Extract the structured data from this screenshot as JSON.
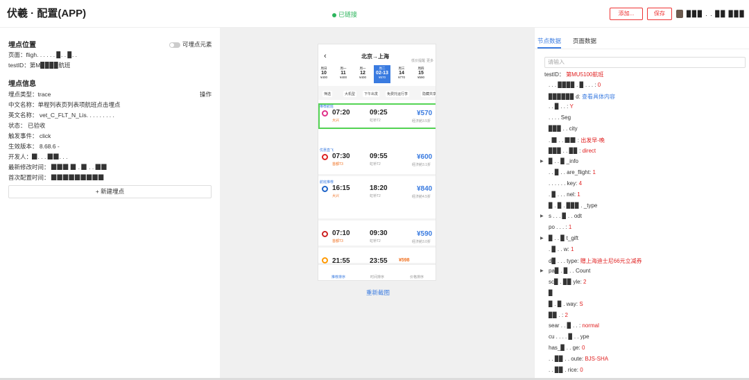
{
  "header": {
    "title": "伏羲 · 配置(APP)",
    "status": "已链接",
    "btn1": "添加...",
    "btn2": "保存",
    "user": "▉▉▉ . . ▉▉ ▉▉▉"
  },
  "left": {
    "pos_title": "埋点位置",
    "toggle_label": "可埋点元素",
    "page_row": "页面：fligh. . . . . . ▉. . ▉. .",
    "testid_row": "testID：第M▉▉▉▉航班",
    "info_title": "埋点信息",
    "ops": "操作",
    "rows": [
      "埋点类型：trace",
      "中文名称：单程列表页列表项航班点击埋点",
      "英文名称：  vet_C_FLT_N_Lis. . . . . . . . .",
      "状态：  已验收",
      "触发事件：  click",
      "生效版本：  8.68.6 -",
      "开发人：▉. . . ▉▉. . .",
      "最新修改时间：  ▉▉▉ ▉ . ▉ . . ▉▉",
      "首次配置时间：  ▉▉▉▉▉▉▉▉▉"
    ],
    "new_btn": "+ 新建埋点"
  },
  "phone": {
    "route": "北京→上海",
    "reset": "重新截图",
    "top_icons": [
      "低价提醒",
      "更多"
    ],
    "dates": [
      {
        "d": "周日",
        "n": "10",
        "p": "¥400"
      },
      {
        "d": "周一",
        "n": "11",
        "p": "¥400"
      },
      {
        "d": "周一",
        "n": "12",
        "p": "¥400"
      },
      {
        "d": "周二",
        "n": "02-13",
        "p": "¥570"
      },
      {
        "d": "周三",
        "n": "14",
        "p": "¥770"
      },
      {
        "d": "周四",
        "n": "15",
        "p": "¥590"
      }
    ],
    "filters": [
      "筛选",
      "大机型",
      "下午出发",
      "免费托运行李",
      "隐藏共享"
    ],
    "flights": [
      {
        "tag": "推荐航班",
        "dep": "07:20",
        "arr": "09:25",
        "price": "¥570",
        "dport": "大兴",
        "aport": "虹桥T2",
        "note": "经济舱3.5折"
      },
      {
        "tag": "优惠直飞",
        "dep": "07:30",
        "arr": "09:55",
        "price": "¥600",
        "dport": "首都T3",
        "aport": "虹桥T2",
        "note": "经济舱3.1折"
      },
      {
        "tag": "航班推荐",
        "dep": "16:15",
        "arr": "18:20",
        "price": "¥840",
        "dport": "大兴",
        "aport": "虹桥T2",
        "note": "经济舱4.5折"
      },
      {
        "tag": "",
        "dep": "07:10",
        "arr": "09:30",
        "price": "¥590",
        "dport": "首都T3",
        "aport": "虹桥T2",
        "note": "经济舱3.0折"
      },
      {
        "tag": "",
        "dep": "21:55",
        "arr": "23:55",
        "price": "¥598",
        "dport": "",
        "aport": "",
        "note": ""
      }
    ],
    "bottom": [
      "推荐排序",
      "时间排序",
      "价格排序"
    ]
  },
  "right": {
    "tab1": "节点数据",
    "tab2": "页面数据",
    "search_placeholder": "请输入",
    "nodes": [
      {
        "k": "testID：",
        "v": "第MU5100航班",
        "c": "",
        "t": "n"
      },
      {
        "k": ". . . ▉▉▉▉ . ▉ . . . :",
        "v": "0",
        "c": "",
        "t": "r"
      },
      {
        "k": "▉▉▉▉▉▉ d:",
        "v": "查看具体内容",
        "c": "",
        "t": "b"
      },
      {
        "k": ". . ▉ . . :",
        "v": "Y",
        "c": "",
        "t": "r"
      },
      {
        "k": ". . . . Seg",
        "v": "",
        "c": "",
        "t": "n"
      },
      {
        "k": "▉▉▉ . . city",
        "v": "",
        "c": "",
        "t": "n"
      },
      {
        "k": ". ▉ . . ▉▉ :",
        "v": "出发早-晚",
        "c": "",
        "t": "r"
      },
      {
        "k": "▉▉▉ . . ▉▉ :",
        "v": "direct",
        "c": "",
        "t": "r"
      },
      {
        "k": "▉ . . ▉ _info",
        "v": "",
        "c": "▶",
        "t": "n"
      },
      {
        "k": ". . ▉ . . are_flight:",
        "v": "1",
        "c": "",
        "t": "r"
      },
      {
        "k": ". . . . . . key:",
        "v": "4",
        "c": "",
        "t": "r"
      },
      {
        "k": ". ▉ . . . nel:",
        "v": "1",
        "c": "",
        "t": "r"
      },
      {
        "k": "▉ . ▉ . ▉▉▉ . _type",
        "v": "",
        "c": "",
        "t": "n"
      },
      {
        "k": "s . . . ▉ . . odt",
        "v": "",
        "c": "▶",
        "t": "n"
      },
      {
        "k": "po . . . :",
        "v": "1",
        "c": "",
        "t": "r"
      },
      {
        "k": "▉ . . ▉ t_gift",
        "v": "",
        "c": "▶",
        "t": "n"
      },
      {
        "k": ". ▉ . . w:",
        "v": "1",
        "c": "",
        "t": "r"
      },
      {
        "k": "d▉ . . . type:",
        "v": "赠上海迪士尼66元立减券",
        "c": "",
        "t": "r"
      },
      {
        "k": "pa▉ . ▉ . . Count",
        "v": "",
        "c": "▶",
        "t": "n"
      },
      {
        "k": "sc▉ . ▉▉ yle:",
        "v": "2",
        "c": "",
        "t": "r"
      },
      {
        "k": "▉",
        "v": "",
        "c": "",
        "t": "n"
      },
      {
        "k": "▉ . ▉ . way:",
        "v": "S",
        "c": "",
        "t": "r"
      },
      {
        "k": "▉▉ . :",
        "v": "2",
        "c": "",
        "t": "r"
      },
      {
        "k": "sear . . ▉ . . :",
        "v": "normal",
        "c": "",
        "t": "r"
      },
      {
        "k": "cu . . . . ▉ . . ype",
        "v": "",
        "c": "",
        "t": "n"
      },
      {
        "k": "has_▉ . . ge:",
        "v": "0",
        "c": "",
        "t": "r"
      },
      {
        "k": ". . ▉▉ . . oute:",
        "v": "BJS-SHA",
        "c": "",
        "t": "r"
      },
      {
        "k": ". . ▉▉ . rice:",
        "v": "0",
        "c": "",
        "t": "r"
      }
    ]
  },
  "colors": {
    "accent": "#3a7be0",
    "red": "#e02020",
    "green": "#2db55d"
  }
}
